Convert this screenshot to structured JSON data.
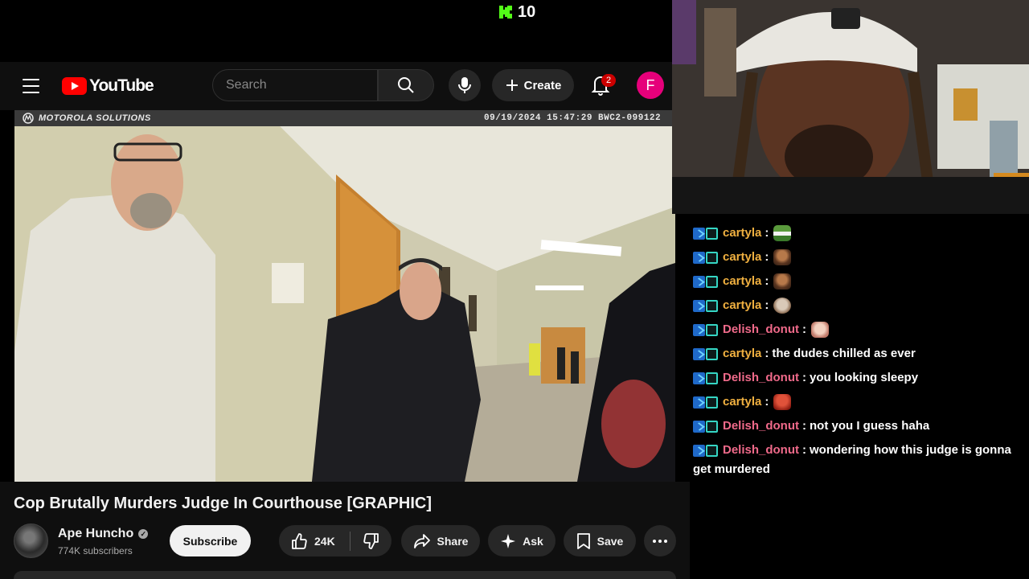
{
  "stream": {
    "viewer_count": "10",
    "platform_icon": "kick-logo-icon",
    "accent": "#53fc18"
  },
  "youtube": {
    "logo_text": "YouTube",
    "search_placeholder": "Search",
    "create_label": "Create",
    "notification_count": "2",
    "avatar_letter": "F",
    "brand_red": "#ff0000"
  },
  "video": {
    "overlay_brand": "MOTOROLA SOLUTIONS",
    "overlay_timestamp": "09/19/2024 15:47:29 BWC2-099122",
    "title": "Cop Brutally Murders Judge In Courthouse [GRAPHIC]"
  },
  "channel": {
    "name": "Ape Huncho",
    "subscribers": "774K subscribers",
    "subscribe_label": "Subscribe"
  },
  "actions": {
    "likes": "24K",
    "share_label": "Share",
    "ask_label": "Ask",
    "save_label": "Save"
  },
  "chat": {
    "messages": [
      {
        "user": "cartyla",
        "text": "",
        "emote": "pepe"
      },
      {
        "user": "cartyla",
        "text": "",
        "emote": "face"
      },
      {
        "user": "cartyla",
        "text": "",
        "emote": "face"
      },
      {
        "user": "cartyla",
        "text": "",
        "emote": "dog"
      },
      {
        "user": "Delish_donut",
        "text": "",
        "emote": "hand"
      },
      {
        "user": "cartyla",
        "text": "the dudes chilled as ever",
        "emote": ""
      },
      {
        "user": "Delish_donut",
        "text": "you looking sleepy",
        "emote": ""
      },
      {
        "user": "cartyla",
        "text": "",
        "emote": "red-face"
      },
      {
        "user": "Delish_donut",
        "text": "not you I guess haha",
        "emote": ""
      },
      {
        "user": "Delish_donut",
        "text": "wondering how this judge is gonna get murdered",
        "emote": ""
      }
    ],
    "user_colors": {
      "cartyla": "#f0b040",
      "Delish_donut": "#f06a8a"
    }
  }
}
